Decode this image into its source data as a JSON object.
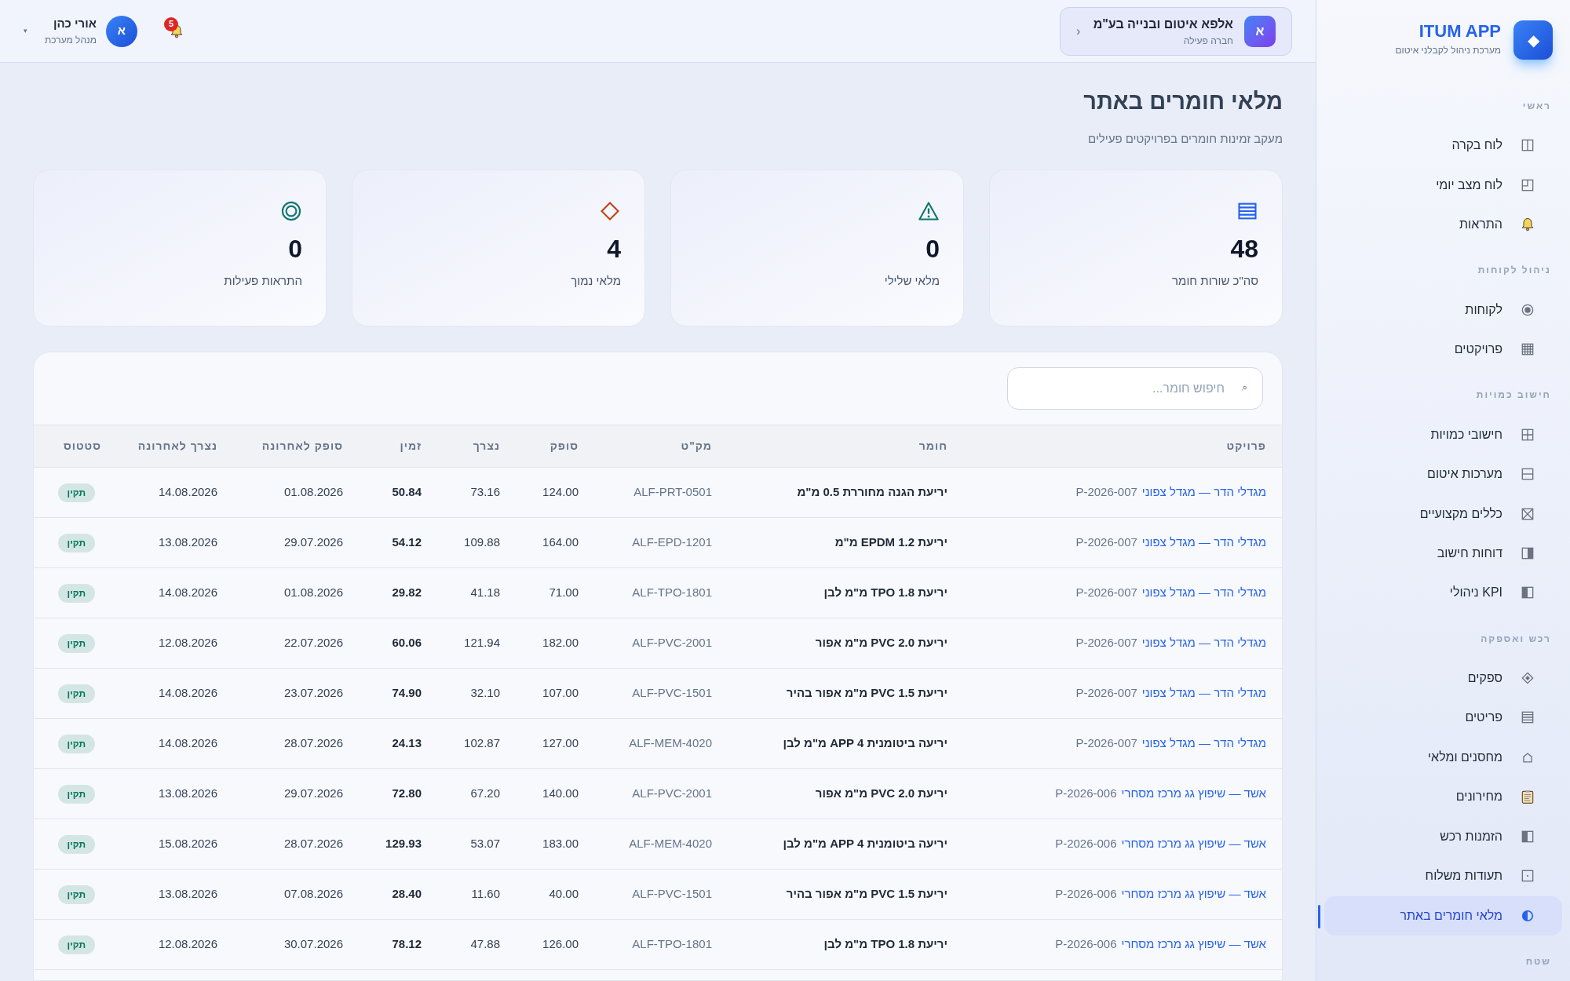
{
  "sidebar": {
    "app_name": "ITUM APP",
    "app_tagline": "מערכת ניהול לקבלני איטום",
    "logo_glyph": "◆",
    "sections": [
      {
        "title": "ראשי",
        "items": [
          {
            "label": "לוח בקרה",
            "selected": false
          },
          {
            "label": "לוח מצב יומי",
            "selected": false
          },
          {
            "label": "התראות",
            "selected": false
          }
        ]
      },
      {
        "title": "ניהול לקוחות",
        "items": [
          {
            "label": "לקוחות",
            "selected": false
          },
          {
            "label": "פרויקטים",
            "selected": false
          }
        ]
      },
      {
        "title": "חישוב כמויות",
        "items": [
          {
            "label": "חישובי כמויות",
            "selected": false
          },
          {
            "label": "מערכות איטום",
            "selected": false
          },
          {
            "label": "כללים מקצועיים",
            "selected": false
          },
          {
            "label": "דוחות חישוב",
            "selected": false
          },
          {
            "label": "KPI ניהולי",
            "selected": false
          }
        ]
      },
      {
        "title": "רכש ואספקה",
        "items": [
          {
            "label": "ספקים",
            "selected": false
          },
          {
            "label": "פריטים",
            "selected": false
          },
          {
            "label": "מחסנים ומלאי",
            "selected": false
          },
          {
            "label": "מחירונים",
            "selected": false
          },
          {
            "label": "הזמנות רכש",
            "selected": false
          },
          {
            "label": "תעודות משלוח",
            "selected": false
          },
          {
            "label": "מלאי חומרים באתר",
            "selected": true
          }
        ]
      },
      {
        "title": "שטח"
      }
    ]
  },
  "header": {
    "company": {
      "avatar": "א",
      "name": "אלפא איטום ובנייה בע\"מ",
      "status": "חברה פעילה",
      "chevron": "‹"
    },
    "notifications": {
      "count": "5"
    },
    "user": {
      "avatar": "א",
      "name": "אורי כהן",
      "role": "מנהל מערכת",
      "caret": "▾"
    }
  },
  "page": {
    "title": "מלאי חומרים באתר",
    "subtitle": "מעקב זמינות חומרים בפרויקטים פעילים"
  },
  "stats": [
    {
      "kind": "total",
      "value": "48",
      "label": "סה\"כ שורות חומר"
    },
    {
      "kind": "negative",
      "value": "0",
      "label": "מלאי שלילי"
    },
    {
      "kind": "low",
      "value": "4",
      "label": "מלאי נמוך"
    },
    {
      "kind": "alerts",
      "value": "0",
      "label": "התראות פעילות"
    }
  ],
  "table": {
    "search": {
      "icon": "⌕",
      "placeholder": "חיפוש חומר..."
    },
    "columns": [
      "פרויקט",
      "חומר",
      "מק\"ט",
      "סופק",
      "נצרך",
      "זמין",
      "סופק לאחרונה",
      "נצרך לאחרונה",
      "סטטוס"
    ],
    "rows": [
      {
        "project": "מגדלי הדר — מגדל צפוני",
        "project_code": "P-2026-007",
        "material": "יריעת הגנה מחוררת 0.5 מ\"מ",
        "sku": "ALF-PRT-0501",
        "supplied": "124.00",
        "consumed": "73.16",
        "available": "50.84",
        "last_supplied": "01.08.2026",
        "last_consumed": "14.08.2026",
        "status": {
          "label": "תקין",
          "color": "#047857"
        }
      },
      {
        "project": "מגדלי הדר — מגדל צפוני",
        "project_code": "P-2026-007",
        "material": "יריעת EPDM 1.2 מ\"מ",
        "sku": "ALF-EPD-1201",
        "supplied": "164.00",
        "consumed": "109.88",
        "available": "54.12",
        "last_supplied": "29.07.2026",
        "last_consumed": "13.08.2026",
        "status": {
          "label": "תקין",
          "color": "#047857"
        }
      },
      {
        "project": "מגדלי הדר — מגדל צפוני",
        "project_code": "P-2026-007",
        "material": "יריעת TPO 1.8 מ\"מ לבן",
        "sku": "ALF-TPO-1801",
        "supplied": "71.00",
        "consumed": "41.18",
        "available": "29.82",
        "last_supplied": "01.08.2026",
        "last_consumed": "14.08.2026",
        "status": {
          "label": "תקין",
          "color": "#047857"
        }
      },
      {
        "project": "מגדלי הדר — מגדל צפוני",
        "project_code": "P-2026-007",
        "material": "יריעת PVC 2.0 מ\"מ אפור",
        "sku": "ALF-PVC-2001",
        "supplied": "182.00",
        "consumed": "121.94",
        "available": "60.06",
        "last_supplied": "22.07.2026",
        "last_consumed": "12.08.2026",
        "status": {
          "label": "תקין",
          "color": "#047857"
        }
      },
      {
        "project": "מגדלי הדר — מגדל צפוני",
        "project_code": "P-2026-007",
        "material": "יריעת PVC 1.5 מ\"מ אפור בהיר",
        "sku": "ALF-PVC-1501",
        "supplied": "107.00",
        "consumed": "32.10",
        "available": "74.90",
        "last_supplied": "23.07.2026",
        "last_consumed": "14.08.2026",
        "status": {
          "label": "תקין",
          "color": "#047857"
        }
      },
      {
        "project": "מגדלי הדר — מגדל צפוני",
        "project_code": "P-2026-007",
        "material": "יריעה ביטומנית APP 4 מ\"מ לבן",
        "sku": "ALF-MEM-4020",
        "supplied": "127.00",
        "consumed": "102.87",
        "available": "24.13",
        "last_supplied": "28.07.2026",
        "last_consumed": "14.08.2026",
        "status": {
          "label": "תקין",
          "color": "#047857"
        }
      },
      {
        "project": "אשד — שיפוץ גג מרכז מסחרי",
        "project_code": "P-2026-006",
        "material": "יריעת PVC 2.0 מ\"מ אפור",
        "sku": "ALF-PVC-2001",
        "supplied": "140.00",
        "consumed": "67.20",
        "available": "72.80",
        "last_supplied": "29.07.2026",
        "last_consumed": "13.08.2026",
        "status": {
          "label": "תקין",
          "color": "#047857"
        }
      },
      {
        "project": "אשד — שיפוץ גג מרכז מסחרי",
        "project_code": "P-2026-006",
        "material": "יריעה ביטומנית APP 4 מ\"מ לבן",
        "sku": "ALF-MEM-4020",
        "supplied": "183.00",
        "consumed": "53.07",
        "available": "129.93",
        "last_supplied": "28.07.2026",
        "last_consumed": "15.08.2026",
        "status": {
          "label": "תקין",
          "color": "#047857"
        }
      },
      {
        "project": "אשד — שיפוץ גג מרכז מסחרי",
        "project_code": "P-2026-006",
        "material": "יריעת PVC 1.5 מ\"מ אפור בהיר",
        "sku": "ALF-PVC-1501",
        "supplied": "40.00",
        "consumed": "11.60",
        "available": "28.40",
        "last_supplied": "07.08.2026",
        "last_consumed": "13.08.2026",
        "status": {
          "label": "תקין",
          "color": "#047857"
        }
      },
      {
        "project": "אשד — שיפוץ גג מרכז מסחרי",
        "project_code": "P-2026-006",
        "material": "יריעת TPO 1.8 מ\"מ לבן",
        "sku": "ALF-TPO-1801",
        "supplied": "126.00",
        "consumed": "47.88",
        "available": "78.12",
        "last_supplied": "30.07.2026",
        "last_consumed": "12.08.2026",
        "status": {
          "label": "תקין",
          "color": "#047857"
        }
      }
    ]
  }
}
